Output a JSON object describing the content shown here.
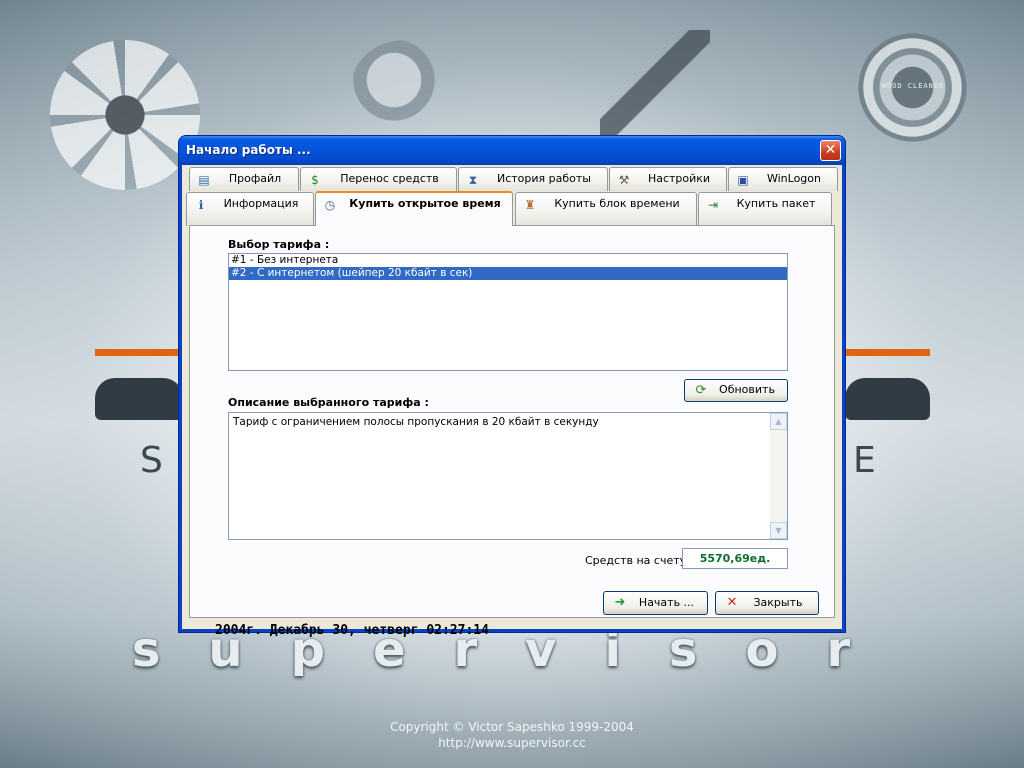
{
  "desktop": {
    "disc_label": "WOOD CLEANER",
    "brand_left_letter": "S",
    "brand_right_letter": "E",
    "product_name": "supervisor",
    "copyright_line1": "Copyright © Victor Sapeshko 1999-2004",
    "copyright_line2": "http://www.supervisor.cc",
    "colors": {
      "orange_line": "#e0640f"
    }
  },
  "dialog": {
    "title": "Начало работы ...",
    "close_label": "✕",
    "tabs_row1": [
      {
        "label": "Профайл",
        "icon": "profile-icon"
      },
      {
        "label": "Перенос средств",
        "icon": "money-transfer-icon"
      },
      {
        "label": "История работы",
        "icon": "history-icon"
      },
      {
        "label": "Настройки",
        "icon": "tools-icon"
      },
      {
        "label": "WinLogon",
        "icon": "winlogon-icon"
      }
    ],
    "tabs_row2": [
      {
        "label": "Информация",
        "icon": "info-icon"
      },
      {
        "label": "Купить открытое время",
        "icon": "clock-icon",
        "active": true
      },
      {
        "label": "Купить блок времени",
        "icon": "block-time-icon"
      },
      {
        "label": "Купить пакет",
        "icon": "package-icon"
      }
    ],
    "tariff_label": "Выбор тарифа :",
    "tariffs": [
      {
        "text": "#1 - Без интернета",
        "selected": false
      },
      {
        "text": "#2 - С интернетом (шейпер 20 кбайт в сек)",
        "selected": true
      }
    ],
    "refresh_button": "Обновить",
    "description_label": "Описание выбранного тарифа :",
    "description_text": "Тариф с ограничением полосы пропускания в 20 кбайт в секунду",
    "balance_label": "Средств на счету :",
    "balance_value": "5570,69ед.",
    "datetime": "2004г. Декабрь 30, четверг  02:27:14",
    "start_button": "Начать ...",
    "close_button": "Закрыть"
  }
}
